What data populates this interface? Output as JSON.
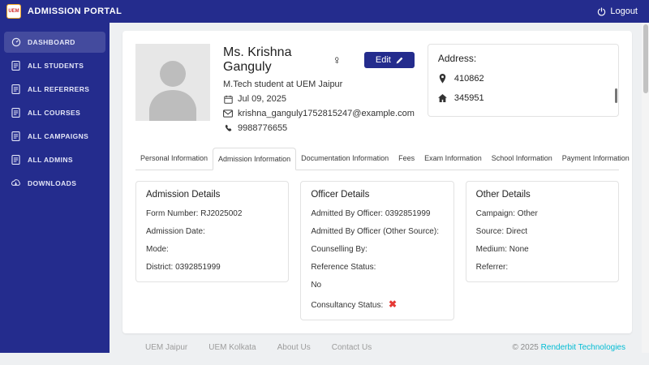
{
  "topbar": {
    "logo": "UEM",
    "title": "ADMISSION PORTAL",
    "logout": "Logout"
  },
  "sidebar": {
    "items": [
      {
        "label": "DASHBOARD",
        "active": true
      },
      {
        "label": "ALL STUDENTS",
        "active": false
      },
      {
        "label": "ALL REFERRERS",
        "active": false
      },
      {
        "label": "ALL COURSES",
        "active": false
      },
      {
        "label": "ALL CAMPAIGNS",
        "active": false
      },
      {
        "label": "ALL ADMINS",
        "active": false
      },
      {
        "label": "DOWNLOADS",
        "active": false
      }
    ]
  },
  "profile": {
    "name": "Ms. Krishna Ganguly",
    "gender_symbol": "♀",
    "subtitle": "M.Tech student at UEM Jaipur",
    "admission_date": "Jul 09, 2025",
    "email": "krishna_ganguly1752815247@example.com",
    "phone": "9988776655",
    "edit_button": "Edit"
  },
  "address": {
    "title": "Address:",
    "pin_code": "410862",
    "house_no": "345951"
  },
  "tabs": [
    "Personal Information",
    "Admission Information",
    "Documentation Information",
    "Fees",
    "Exam Information",
    "School Information",
    "Payment Information"
  ],
  "active_tab": "Admission Information",
  "admission_details": {
    "title": "Admission Details",
    "rows": [
      {
        "label": "Form Number:",
        "value": "RJ2025002"
      },
      {
        "label": "Admission Date:",
        "value": ""
      },
      {
        "label": "Mode:",
        "value": ""
      },
      {
        "label": "District:",
        "value": "0392851999"
      }
    ]
  },
  "officer_details": {
    "title": "Officer Details",
    "rows": [
      {
        "label": "Admitted By Officer:",
        "value": "0392851999"
      },
      {
        "label": "Admitted By Officer (Other Source):",
        "value": ""
      },
      {
        "label": "Counselling By:",
        "value": ""
      },
      {
        "label": "Reference Status:",
        "value": ""
      },
      {
        "label": "",
        "value": "No"
      },
      {
        "label": "Consultancy Status:",
        "value": ""
      }
    ],
    "x_mark": "✖"
  },
  "other_details": {
    "title": "Other Details",
    "rows": [
      {
        "label": "Campaign:",
        "value": "Other"
      },
      {
        "label": "Source:",
        "value": "Direct"
      },
      {
        "label": "Medium:",
        "value": "None"
      },
      {
        "label": "Referrer:",
        "value": ""
      }
    ]
  },
  "footer": {
    "links": [
      "UEM Jaipur",
      "UEM Kolkata",
      "About Us",
      "Contact Us"
    ],
    "copyright": "© 2025",
    "company": "Renderbit Technologies"
  },
  "colors": {
    "brand_indigo": "#242c8d",
    "link_cyan": "#00bcd4",
    "error_red": "#e53935"
  }
}
